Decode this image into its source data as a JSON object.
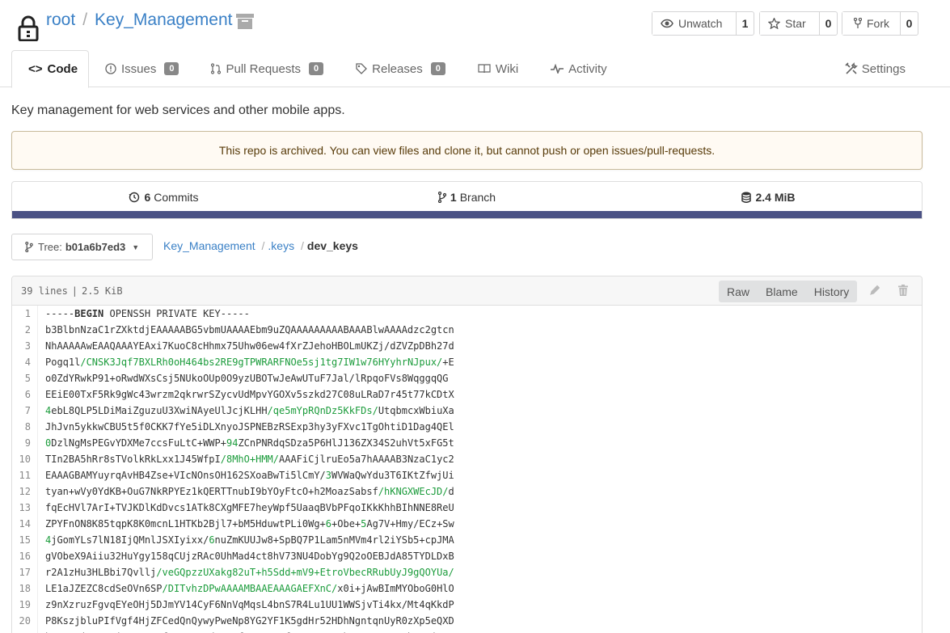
{
  "header": {
    "owner": "root",
    "separator": "/",
    "repo": "Key_Management",
    "watch": {
      "label": "Unwatch",
      "count": "1"
    },
    "star": {
      "label": "Star",
      "count": "0"
    },
    "fork": {
      "label": "Fork",
      "count": "0"
    }
  },
  "tabs": [
    {
      "label": "Code",
      "icon": "code-icon"
    },
    {
      "label": "Issues",
      "badge": "0",
      "icon": "issue-icon"
    },
    {
      "label": "Pull Requests",
      "badge": "0",
      "icon": "pull-request-icon"
    },
    {
      "label": "Releases",
      "badge": "0",
      "icon": "tag-icon"
    },
    {
      "label": "Wiki",
      "icon": "book-icon"
    },
    {
      "label": "Activity",
      "icon": "pulse-icon"
    }
  ],
  "settings_label": "Settings",
  "description": "Key management for web services and other mobile apps.",
  "archived_message": "This repo is archived. You can view files and clone it, but cannot push or open issues/pull-requests.",
  "stats": {
    "commits_count": "6",
    "commits_label": "Commits",
    "branch_count": "1",
    "branch_label": "Branch",
    "size": "2.4 MiB"
  },
  "tree": {
    "label": "Tree:",
    "ref": "b01a6b7ed3"
  },
  "breadcrumb": {
    "root": "Key_Management",
    "dir": ".keys",
    "file": "dev_keys",
    "separator": "/"
  },
  "file": {
    "lines_info": "39 lines",
    "size_info": "2.5 KiB",
    "buttons": {
      "raw": "Raw",
      "blame": "Blame",
      "history": "History"
    }
  },
  "code_lines": [
    {
      "n": "1",
      "segs": [
        [
          "-----",
          ""
        ],
        [
          "BEGIN",
          "kw"
        ],
        [
          " OPENSSH PRIVATE KEY-----",
          ""
        ]
      ]
    },
    {
      "n": "2",
      "segs": [
        [
          "b3BlbnNzaC1rZXktdjEAAAAABG5vbmUAAAAEbm9uZQAAAAAAAAABAAABlwAAAAdzc2gtcn",
          ""
        ]
      ]
    },
    {
      "n": "3",
      "segs": [
        [
          "NhAAAAAwEAAQAAAYEAxi7KuoC8cHhmx75Uhw06ew4fXrZJehoHBOLmUKZj/dZVZpDBh27d",
          ""
        ]
      ]
    },
    {
      "n": "4",
      "segs": [
        [
          "Pogq1l",
          ""
        ],
        [
          "/CNSK3Jqf7BXLRh0oH464bs2RE9gTPWRARFNOe5sj1tg7IW1w76HYyhrNJpux/",
          "g"
        ],
        [
          "+E",
          ""
        ]
      ]
    },
    {
      "n": "5",
      "segs": [
        [
          "o0ZdYRwkP91+oRwdWXsCsj5NUkoOUp0O9yzUBOTwJeAwUTuF7Jal/lRpqoFVs8WqggqQG",
          ""
        ]
      ]
    },
    {
      "n": "6",
      "segs": [
        [
          "EEiE00TxF5Rk9gWc43wrzm2qkrwrSZycvUdMpvYGOXv5szkd27C08uLRaD7r45t77kCDtX",
          ""
        ]
      ]
    },
    {
      "n": "7",
      "segs": [
        [
          "4",
          "g"
        ],
        [
          "ebL8QLP5LDiMaiZguzuU3XwiNAyeUlJcjKLHH",
          ""
        ],
        [
          "/qe5mYpRQnDz5KkFDs/",
          "g"
        ],
        [
          "UtqbmcxWbiuXa",
          ""
        ]
      ]
    },
    {
      "n": "8",
      "segs": [
        [
          "JhJvn5ykkwCBU5t5f0CKK7fYe5iDLXnyoJSPNEBzRSExp3hy3yFXvc1TgOhtiD1Dag4QEl",
          ""
        ]
      ]
    },
    {
      "n": "9",
      "segs": [
        [
          "0",
          "g"
        ],
        [
          "DzlNgMsPEGvYDXMe7ccsFuLtC+WWP+",
          ""
        ],
        [
          "94",
          "g"
        ],
        [
          "ZCnPNRdqSDza5P6HlJ136ZX34S2uhVt5xFG5t",
          ""
        ]
      ]
    },
    {
      "n": "10",
      "segs": [
        [
          "TIn2BA5hRr8sTVolkRkLxx1J45WfpI",
          ""
        ],
        [
          "/8MhO+HMM/",
          "g"
        ],
        [
          "AAAFiCjlruEo5a7hAAAAB3NzaC1yc2",
          ""
        ]
      ]
    },
    {
      "n": "11",
      "segs": [
        [
          "EAAAGBAMYuyrqAvHB4Zse+VIcNOnsOH162SXoaBwTi5lCmY/",
          ""
        ],
        [
          "3",
          "g"
        ],
        [
          "WVWaQwYdu3T6IKtZfwjUi",
          ""
        ]
      ]
    },
    {
      "n": "12",
      "segs": [
        [
          "tyan+wVy0YdKB+OuG7NkRPYEz1kQERTTnubI9bYOyFtcO+h2MoazSabsf",
          ""
        ],
        [
          "/hKNGXWEcJD/",
          "g"
        ],
        [
          "d",
          ""
        ]
      ]
    },
    {
      "n": "13",
      "segs": [
        [
          "fqEcHVl7ArI+TVJKDlKdDvcs1ATk8CXgMFE7heyWpf5UaaqBVbPFqoIKkKhhBIhNNE8ReU",
          ""
        ]
      ]
    },
    {
      "n": "14",
      "segs": [
        [
          "ZPYFnON8K85tqpK8K0mcnL1HTKb2Bjl7+bM5HduwtPLi0Wg+",
          ""
        ],
        [
          "6",
          "g"
        ],
        [
          "+Obe+",
          ""
        ],
        [
          "5",
          "g"
        ],
        [
          "Ag7V+Hmy/ECz+Sw",
          ""
        ]
      ]
    },
    {
      "n": "15",
      "segs": [
        [
          "4",
          "g"
        ],
        [
          "jGomYLs7lN18IjQMnlJSXIyixx/",
          ""
        ],
        [
          "6",
          "g"
        ],
        [
          "nuZmKUUJw8+SpBQ7P1Lam5nMVm4rl2iYSb5+cpJMA",
          ""
        ]
      ]
    },
    {
      "n": "16",
      "segs": [
        [
          "gVObeX9Aiiu32HuYgy158qCUjzRAc0UhMad4ct8hV73NU4DobYg9Q2oOEBJdA85TYDLDxB",
          ""
        ]
      ]
    },
    {
      "n": "17",
      "segs": [
        [
          "r2A1zHu3HLBbi7Qvllj",
          ""
        ],
        [
          "/veGQpzzUXakg82uT+h5Sdd+mV9+EtroVbecRRubUyJ9gQOYUa/",
          "g"
        ]
      ]
    },
    {
      "n": "18",
      "segs": [
        [
          "LE1aJZEZC8cdSeOVn6SP",
          ""
        ],
        [
          "/DITvhzDPwAAAAMBAAEAAAGAEFXnC/",
          "g"
        ],
        [
          "x0i+jAwBImMYOboG0HlO",
          ""
        ]
      ]
    },
    {
      "n": "19",
      "segs": [
        [
          "z9nXzruzFgvqEYeOHj5DJmYV14CyF6NnVqMqsL4bnS7R4Lu1UU1WWSjvTi4kx/Mt4qKkdP",
          ""
        ]
      ]
    },
    {
      "n": "20",
      "segs": [
        [
          "P8KszjbluPIfVgf4HjZFCedQnQywyPweNp8YG2YF1K5gdHr52HDhNgntqnUyR0zXp5eQXD",
          ""
        ]
      ]
    },
    {
      "n": "21",
      "segs": [
        [
          "bzQsFZjnWD0gjmpq5mPXf8P7SAmsd92NCf/1J4KT6fAzo8rN+MJhzzFJaGP9nLb1ERjUsY",
          ""
        ]
      ]
    }
  ]
}
